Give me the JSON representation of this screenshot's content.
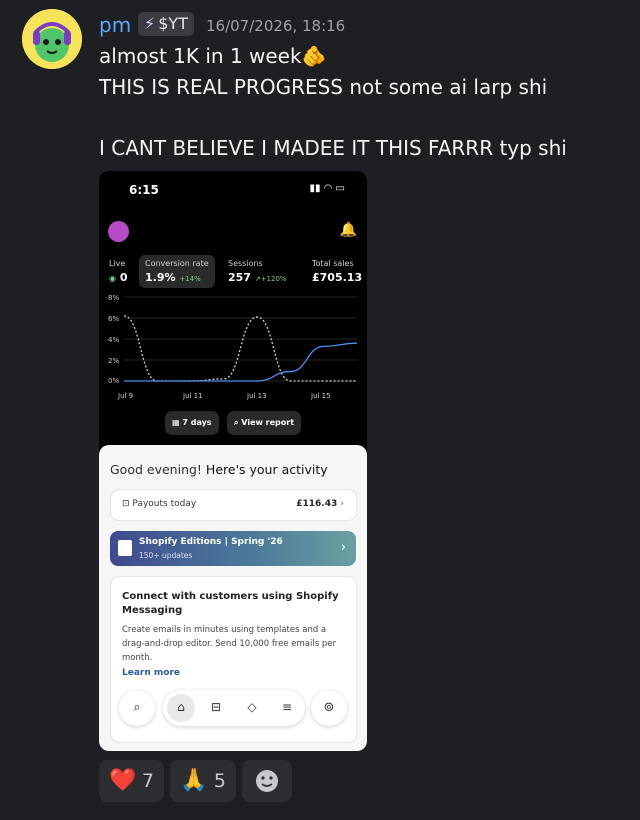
{
  "message": {
    "username": "pm",
    "tag": "$YT",
    "timestamp": "16/07/2026, 18:16",
    "lines": [
      "almost 1K in 1 week🫵",
      "THIS IS REAL PROGRESS not some ai larp shi",
      "I CANT BELIEVE I MADEE IT THIS FARRR typ shi"
    ]
  },
  "phone": {
    "time": "6:15",
    "metrics": {
      "live_label": "Live",
      "live_value": "0",
      "conv_label": "Conversion rate",
      "conv_value": "1.9%",
      "conv_delta": "+14%",
      "sessions_label": "Sessions",
      "sessions_value": "257",
      "sessions_delta": "+120%",
      "sales_label": "Total sales",
      "sales_value": "£705.13"
    },
    "chart": {
      "y_ticks": [
        "8%",
        "6%",
        "4%",
        "2%",
        "0%"
      ],
      "x_ticks": [
        "Jul 9",
        "Jul 11",
        "Jul 13",
        "Jul 15"
      ]
    },
    "buttons": {
      "range": "7 days",
      "report": "View report"
    },
    "greeting_prefix": "Good evening!",
    "greeting_suffix": "Here's your activity",
    "payouts_label": "Payouts today",
    "payouts_value": "£116.43",
    "banner_title": "Shopify Editions | Spring '26",
    "banner_sub": "150+ updates",
    "promo_title": "Connect with customers using Shopify Messaging",
    "promo_body": "Create emails in minutes using templates and a drag-and-drop editor. Send 10,000 free emails per month.",
    "promo_link": "Learn more"
  },
  "reactions": [
    {
      "emoji": "❤️",
      "count": "7"
    },
    {
      "emoji": "🙏",
      "count": "5"
    }
  ],
  "chart_data": {
    "type": "line",
    "x": [
      "Jul 9",
      "Jul 10",
      "Jul 11",
      "Jul 12",
      "Jul 13",
      "Jul 14",
      "Jul 15",
      "Jul 16"
    ],
    "series": [
      {
        "values": [
          0,
          0,
          0,
          0,
          0,
          0.9,
          3.3,
          3.6
        ]
      },
      {
        "values": [
          6.2,
          0,
          0,
          0.2,
          6.1,
          0,
          0,
          0
        ]
      }
    ],
    "y_ticks": [
      "8%",
      "6%",
      "4%",
      "2%",
      "0%"
    ],
    "x_ticks": [
      "Jul 9",
      "Jul 11",
      "Jul 13",
      "Jul 15"
    ],
    "ylim": [
      0,
      8
    ],
    "grid": true
  }
}
